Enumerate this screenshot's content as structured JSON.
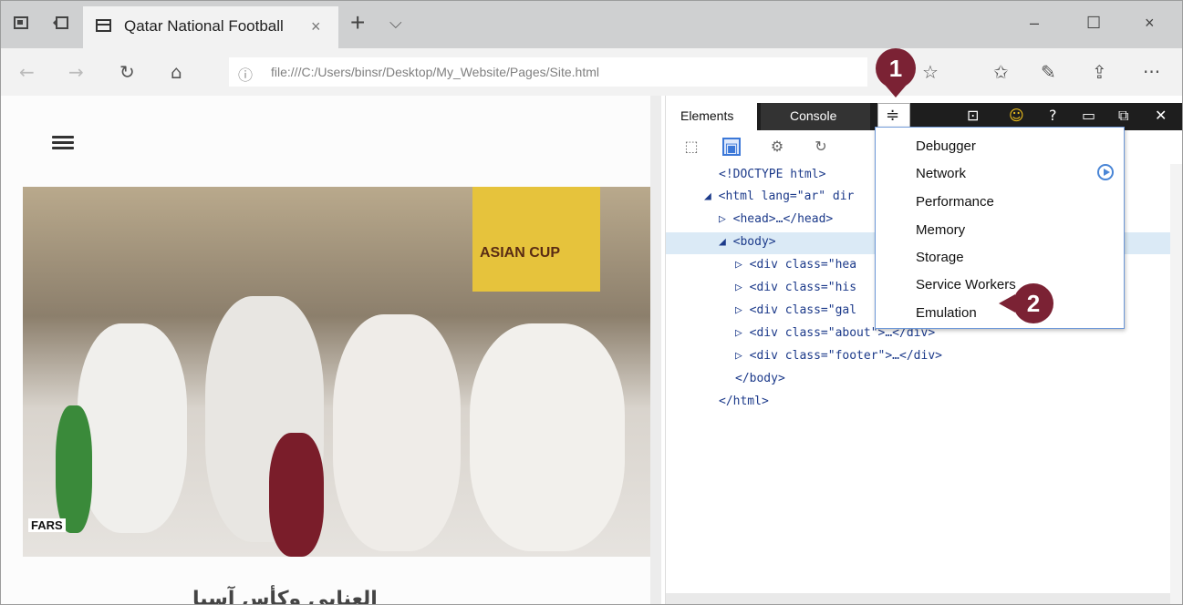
{
  "browser": {
    "tab_title": "Qatar National Football",
    "tab_close": "×",
    "new_tab": "+",
    "tab_list": "⌵",
    "window_controls": {
      "minimize": "–",
      "maximize": "☐",
      "close": "×"
    },
    "nav": {
      "back": "←",
      "forward": "→",
      "refresh": "↻",
      "home": "⌂"
    },
    "url": "file:///C:/Users/binsr/Desktop/My_Website/Pages/Site.html",
    "toolbar_icons": [
      "favorite-star-icon",
      "favorites-list-icon",
      "pen-icon",
      "share-icon",
      "more-icon"
    ],
    "more": "···"
  },
  "page": {
    "banner_text": "ASIAN CUP",
    "photo_credit": "FARS",
    "arabic_heading": "ﺍﻟﻌﻨﺎﺑﻲ ﻭﻛﺄﺱ ﺁﺳﻴﺎ"
  },
  "devtools": {
    "tabs": {
      "elements": "Elements",
      "console": "Console"
    },
    "dom": [
      {
        "text": "<!DOCTYPE html>"
      },
      {
        "text": "◢ <html lang=\"ar\" dir"
      },
      {
        "text": "▷ <head>…</head>"
      },
      {
        "text": "◢ <body>"
      },
      {
        "text": "▷ <div class=\"hea"
      },
      {
        "text": "▷ <div class=\"his"
      },
      {
        "text": "▷ <div class=\"gal"
      },
      {
        "text": "▷ <div class=\"about\">…</div>"
      },
      {
        "text": "▷ <div class=\"footer\">…</div>"
      },
      {
        "text": "</body>"
      },
      {
        "text": "</html>"
      }
    ],
    "menu": {
      "items": [
        "Debugger",
        "Network",
        "Performance",
        "Memory",
        "Storage",
        "Service Workers",
        "Emulation"
      ]
    }
  },
  "callouts": {
    "one": "1",
    "two": "2"
  },
  "colors": {
    "callout": "#7b2234",
    "dt_dark": "#1e1e1e",
    "menu_border": "#6e98d8",
    "selected_row": "#dbeaf6"
  }
}
